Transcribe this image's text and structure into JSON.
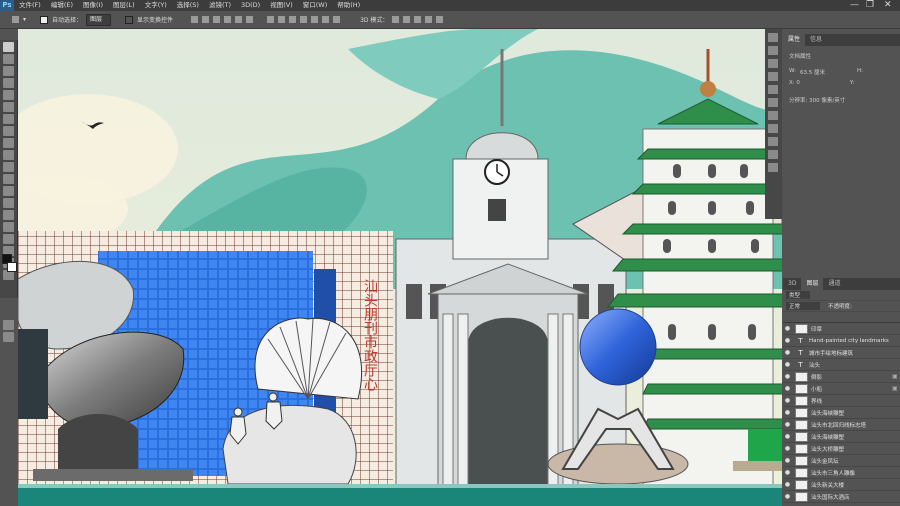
{
  "app": {
    "logo": "Ps"
  },
  "menu": [
    "文件(F)",
    "编辑(E)",
    "图像(I)",
    "图层(L)",
    "文字(Y)",
    "选择(S)",
    "滤镜(T)",
    "3D(D)",
    "视图(V)",
    "窗口(W)",
    "帮助(H)"
  ],
  "window_controls": {
    "minimize": "—",
    "restore": "❐",
    "close": "✕"
  },
  "options": {
    "auto_select_label": "自动选择：",
    "auto_select_value": "图层",
    "show_transform_label": "显示变换控件",
    "mode_label": "3D 模式："
  },
  "properties_panel": {
    "tabs": [
      "属性",
      "信息"
    ],
    "doc_label": "文档属性",
    "w_label": "W:",
    "w_value": "63.5 厘米",
    "h_label": "H:",
    "x_label": "X: 0",
    "y_label": "Y:",
    "resolution": "分辨率: 300 像素/英寸"
  },
  "layers_panel": {
    "tabs": [
      "3D",
      "图层",
      "通道"
    ],
    "filter_kind": "类型",
    "blend_mode": "正常",
    "opacity_label": "不透明度:",
    "layers": [
      {
        "name": "印章",
        "type": "image"
      },
      {
        "name": "Hand-painted city landmarks",
        "type": "text"
      },
      {
        "name": "城市手绘地标建筑",
        "type": "text"
      },
      {
        "name": "汕头",
        "type": "text"
      },
      {
        "name": "倒影",
        "type": "image",
        "lock": true
      },
      {
        "name": "小船",
        "type": "image",
        "lock": true
      },
      {
        "name": "界线",
        "type": "image"
      },
      {
        "name": "汕头海峡雕塑",
        "type": "image"
      },
      {
        "name": "汕头市北回归线标志塔",
        "type": "image"
      },
      {
        "name": "汕头海峡雕塑",
        "type": "image"
      },
      {
        "name": "汕头大桥雕塑",
        "type": "image"
      },
      {
        "name": "汕头金凤坛",
        "type": "image"
      },
      {
        "name": "汕头市三角人雕像",
        "type": "image"
      },
      {
        "name": "汕头新关大楼",
        "type": "image"
      },
      {
        "name": "汕头国际大酒店",
        "type": "image"
      }
    ]
  },
  "artwork": {
    "billboard_text": "汕头朋刊市政厅心",
    "clock_icon": "clock-icon",
    "colors": {
      "sky": "#e8ead3",
      "mountain": "#6cc1b1",
      "mountain_dark": "#4fae9c",
      "glass": "#2a6fe0",
      "pagoda_green": "#2f8f4a",
      "sphere": "#2f63d9",
      "water": "#1a8579"
    }
  }
}
